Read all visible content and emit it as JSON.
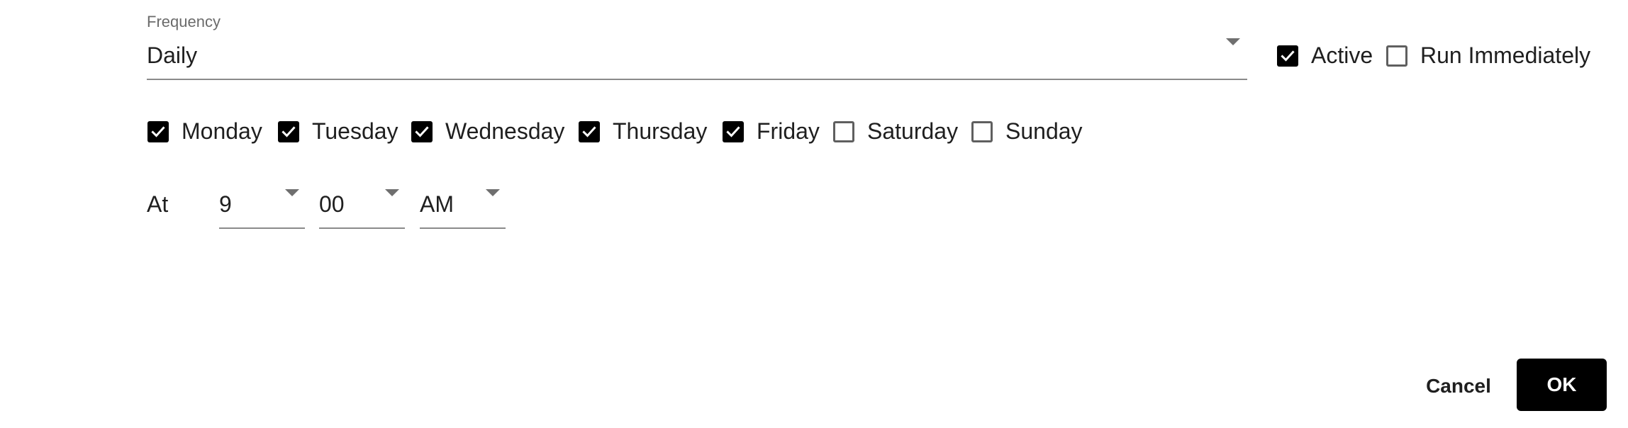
{
  "frequency": {
    "label": "Frequency",
    "value": "Daily"
  },
  "options": {
    "active": {
      "label": "Active",
      "checked": true
    },
    "run_immediately": {
      "label": "Run Immediately",
      "checked": false
    }
  },
  "days": [
    {
      "label": "Monday",
      "checked": true
    },
    {
      "label": "Tuesday",
      "checked": true
    },
    {
      "label": "Wednesday",
      "checked": true
    },
    {
      "label": "Thursday",
      "checked": true
    },
    {
      "label": "Friday",
      "checked": true
    },
    {
      "label": "Saturday",
      "checked": false
    },
    {
      "label": "Sunday",
      "checked": false
    }
  ],
  "time": {
    "at_label": "At",
    "hour": "9",
    "minute": "00",
    "ampm": "AM"
  },
  "actions": {
    "cancel_label": "Cancel",
    "ok_label": "OK"
  },
  "colors": {
    "checkbox_checked": "#000000",
    "primary_button": "#000000"
  }
}
